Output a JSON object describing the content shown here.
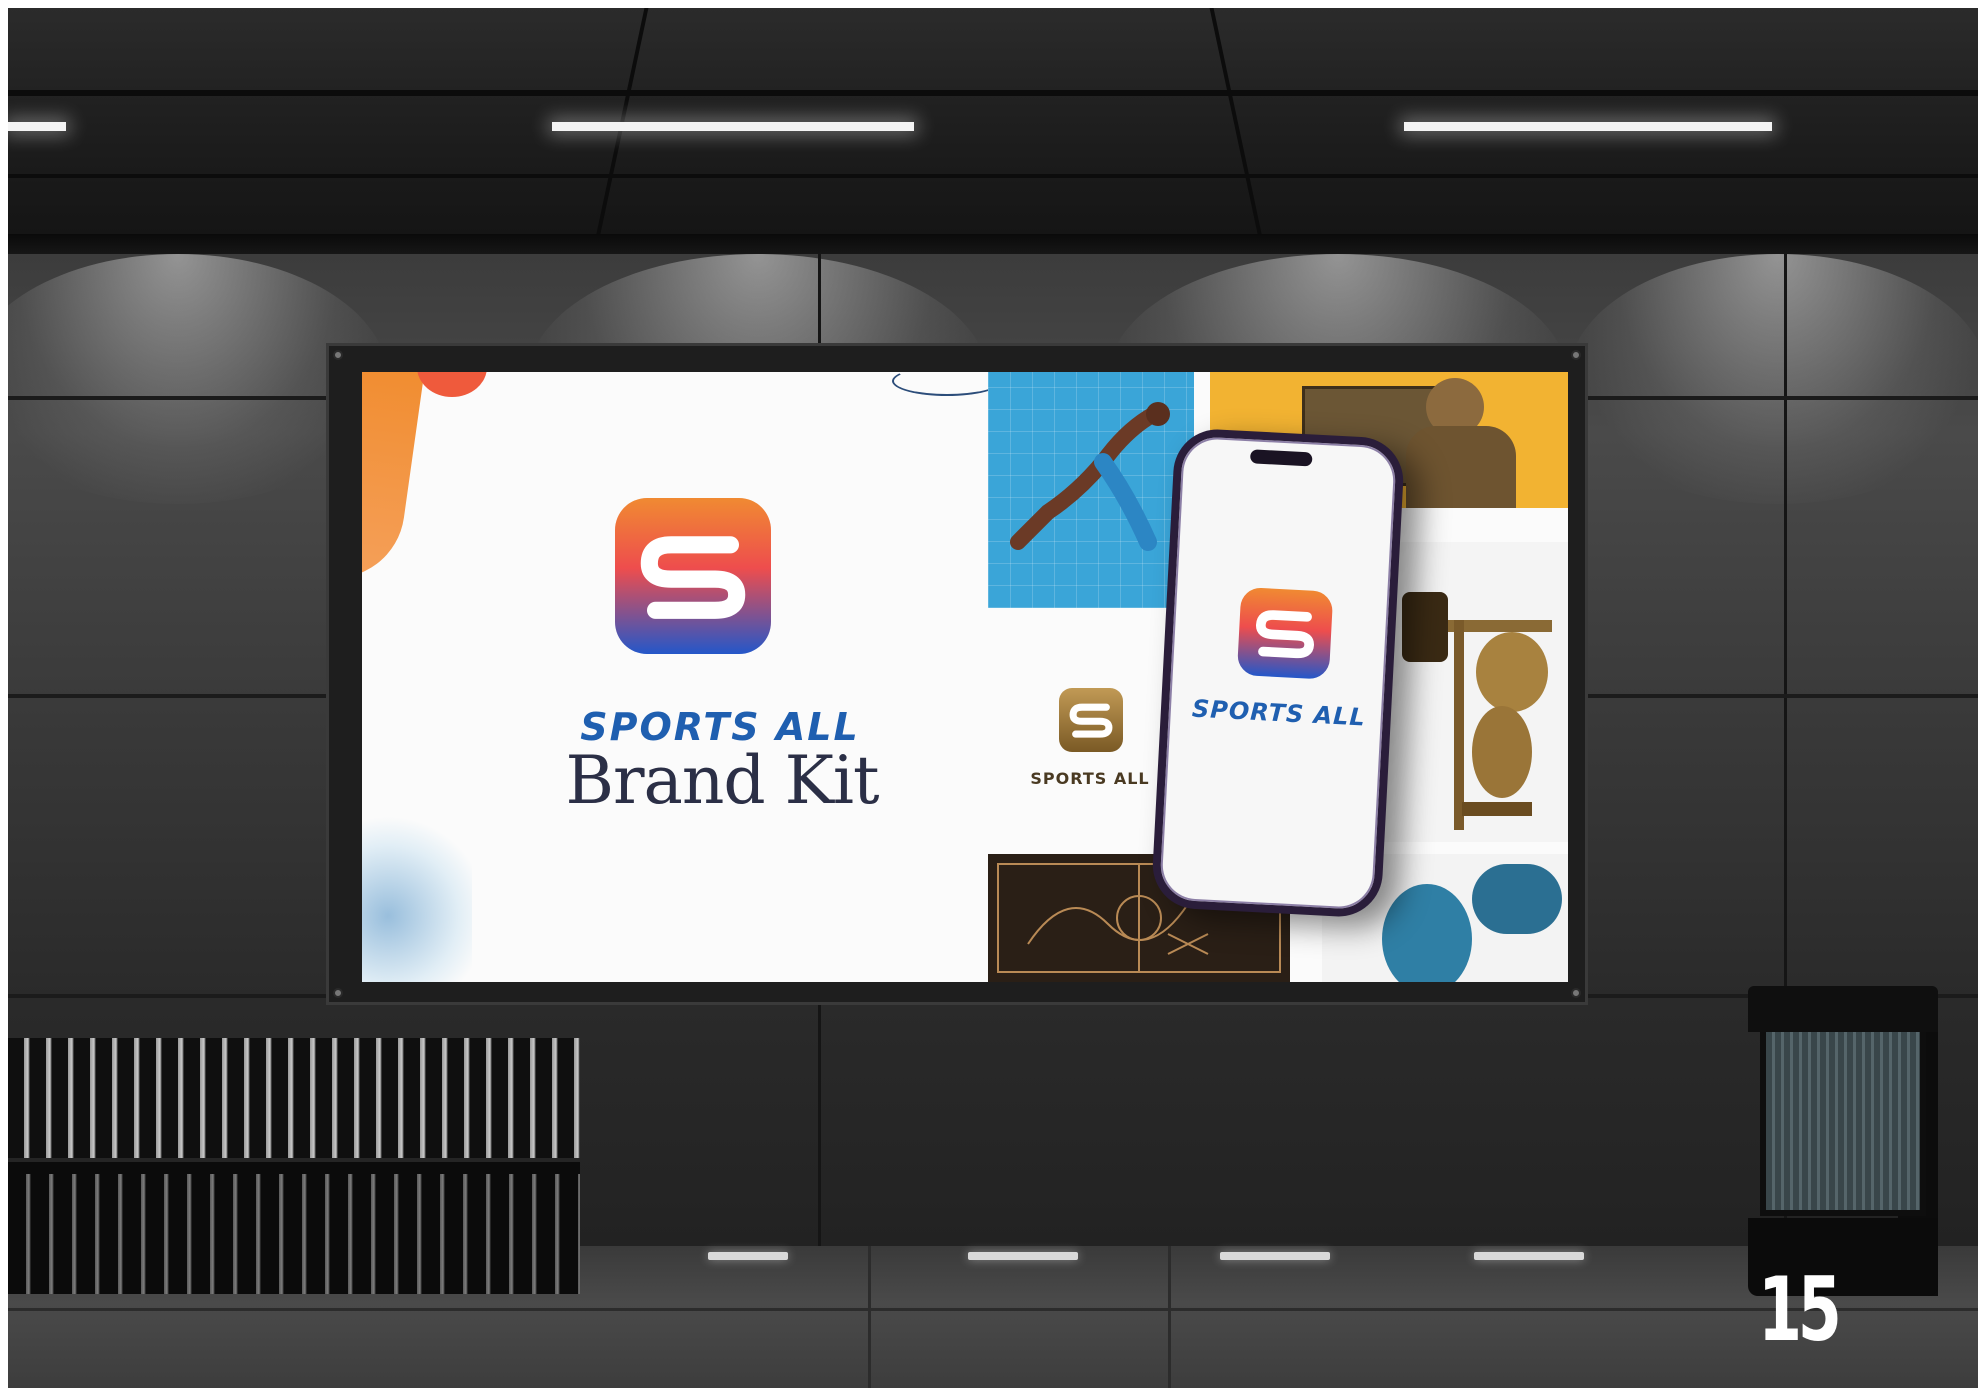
{
  "poster": {
    "brand_name": "SPORTS ALL",
    "headline": "Brand Kit",
    "gold_logo_label": "SPORTS ALL",
    "phone_logo_label": "SPORTS ALL"
  },
  "page_number": "15",
  "icons": {
    "main_logo": "sports-all-s-logo",
    "gold_logo": "sports-all-s-logo-gold",
    "phone_logo": "sports-all-s-logo"
  },
  "colors": {
    "brand_blue": "#1f5fb0",
    "logo_orange": "#f08a32",
    "logo_red": "#ee4d4d",
    "logo_blue": "#2457c9",
    "tile_blue": "#3aa5d8",
    "tile_yellow": "#f2b332",
    "gold": "#9c7a3a"
  }
}
